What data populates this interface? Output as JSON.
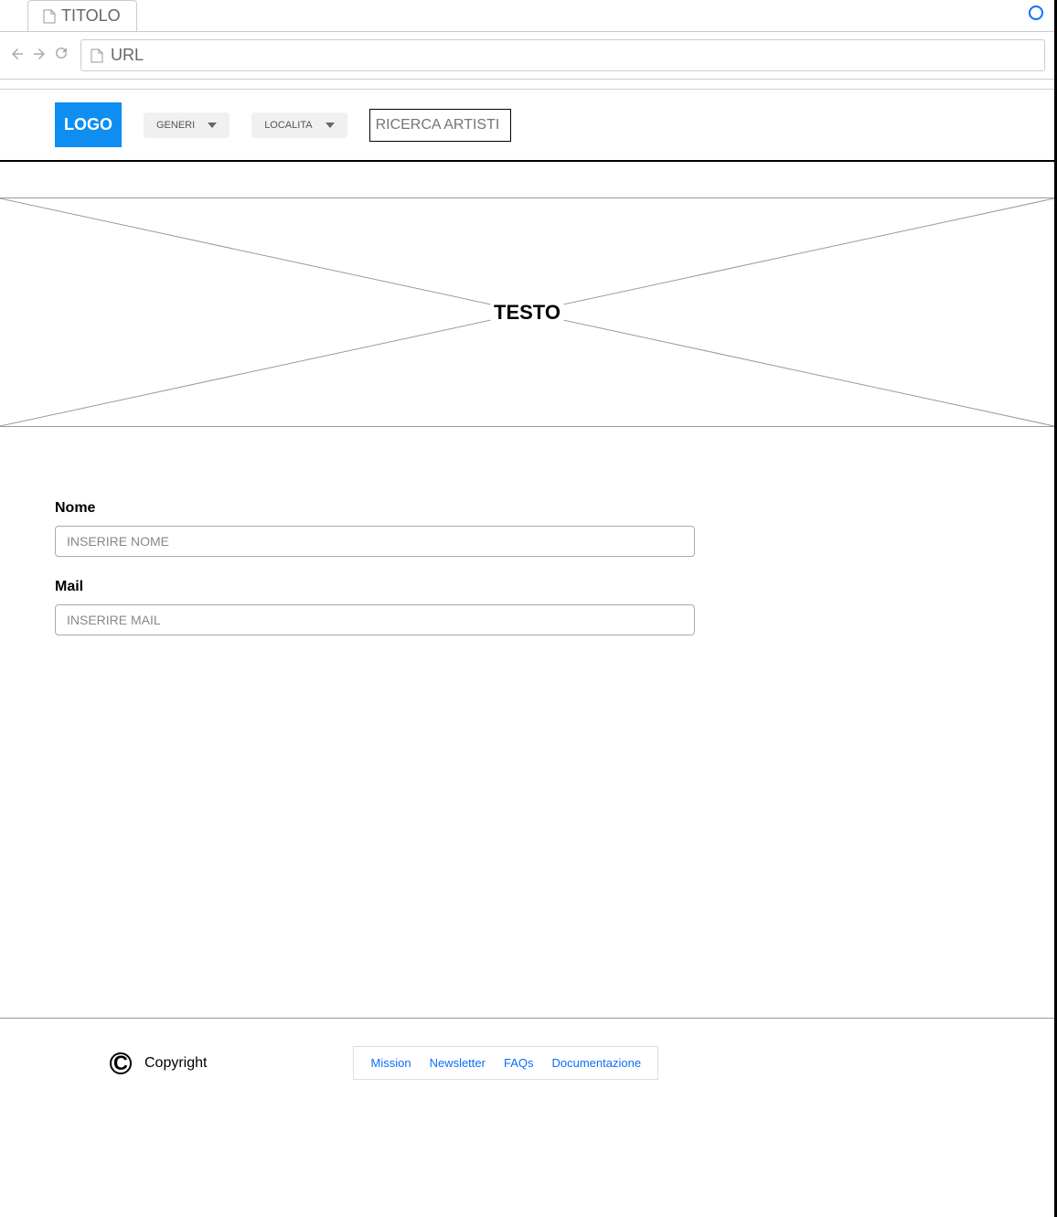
{
  "browser": {
    "tab_title": "TITOLO",
    "url_text": "URL"
  },
  "header": {
    "logo_text": "LOGO",
    "dropdowns": [
      {
        "label": "GENERI"
      },
      {
        "label": "LOCALITA"
      }
    ],
    "search_placeholder": "RICERCA ARTISTI"
  },
  "hero": {
    "text": "TESTO"
  },
  "form": {
    "fields": [
      {
        "label": "Nome",
        "placeholder": "INSERIRE NOME"
      },
      {
        "label": "Mail",
        "placeholder": "INSERIRE MAIL"
      }
    ]
  },
  "footer": {
    "copyright_text": "Copyright",
    "links": [
      {
        "label": "Mission"
      },
      {
        "label": "Newsletter"
      },
      {
        "label": "FAQs"
      },
      {
        "label": "Documentazione"
      }
    ]
  }
}
